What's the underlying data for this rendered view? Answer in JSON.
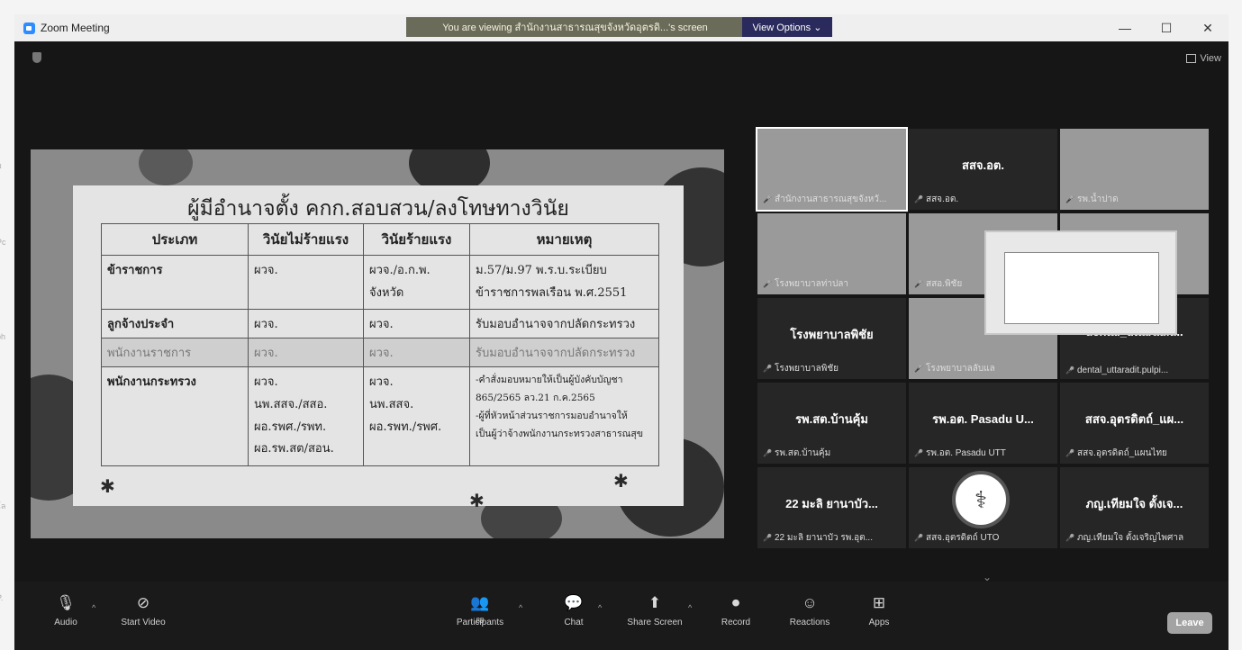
{
  "window": {
    "title": "Zoom Meeting",
    "viewing_banner": "You are viewing สำนักงานสาธารณสุขจังหวัดอุตรดิ...'s screen",
    "view_options": "View Options ⌄",
    "minimize": "—",
    "maximize": "☐",
    "close": "✕",
    "view_label": "View"
  },
  "slide": {
    "title": "ผู้มีอำนาจตั้ง คกก.สอบสวน/ลงโทษทางวินัย",
    "headers": [
      "ประเภท",
      "วินัยไม่ร้ายแรง",
      "วินัยร้ายแรง",
      "หมายเหตุ"
    ],
    "rows": [
      {
        "type": "ข้าราชการ",
        "minor": [
          "ผวจ."
        ],
        "major": [
          "ผวจ./อ.ก.พ.",
          "จังหวัด"
        ],
        "note": [
          "ม.57/ม.97 พ.ร.บ.ระเบียบ",
          "ข้าราชการพลเรือน พ.ศ.2551"
        ]
      },
      {
        "type": "ลูกจ้างประจำ",
        "minor": [
          "ผวจ."
        ],
        "major": [
          "ผวจ."
        ],
        "note": [
          "รับมอบอำนาจจากปลัดกระทรวง"
        ]
      },
      {
        "type": "พนักงานราชการ",
        "minor": [
          "ผวจ."
        ],
        "major": [
          "ผวจ."
        ],
        "note": [
          "รับมอบอำนาจจากปลัดกระทรวง"
        ]
      },
      {
        "type": "พนักงานกระทรวง",
        "minor": [
          "ผวจ.",
          "นพ.สสจ./สสอ.",
          "ผอ.รพศ./รพท.",
          "ผอ.รพ.สต/สอน."
        ],
        "major": [
          "ผวจ.",
          "นพ.สสจ.",
          "ผอ.รพท./รพศ."
        ],
        "note": [
          "-คำสั่งมอบหมายให้เป็นผู้บังคับบัญชา",
          "865/2565 ลว.21 ก.ค.2565",
          "-ผู้ที่หัวหน้าส่วนราชการมอบอำนาจให้",
          "เป็นผู้ว่าจ้างพนักงานกระทรวงสาธารณสุข"
        ]
      }
    ]
  },
  "gallery": [
    {
      "name": "",
      "label": "สำนักงานสาธารณสุขจังหวั..."
    },
    {
      "name": "สสจ.อต.",
      "label": "สสจ.อต."
    },
    {
      "name": "",
      "label": "รพ.น้ำปาด"
    },
    {
      "name": "",
      "label": "โรงพยาบาลท่าปลา"
    },
    {
      "name": "",
      "label": "สสอ.พิชัย"
    },
    {
      "name": "",
      "label": ""
    },
    {
      "name": "โรงพยาบาลพิชัย",
      "label": "โรงพยาบาลพิชัย"
    },
    {
      "name": "",
      "label": "โรงพยาบาลลับแล"
    },
    {
      "name": "dental_uttaradit...",
      "label": "dental_uttaradit.pulpi..."
    },
    {
      "name": "รพ.สต.บ้านคุ้ม",
      "label": "รพ.สต.บ้านคุ้ม"
    },
    {
      "name": "รพ.อต. Pasadu U...",
      "label": "รพ.อต. Pasadu UTT"
    },
    {
      "name": "สสจ.อุตรดิตถ์_แผ...",
      "label": "สสจ.อุตรดิตถ์_แผนไทย"
    },
    {
      "name": "22 มะลิ ยานาบัว...",
      "label": "22 มะลิ ยานาบัว รพ.อุต..."
    },
    {
      "name": "",
      "label": "สสจ.อุตรดิตถ์ UTO"
    },
    {
      "name": "ภญ.เทียมใจ ตั้งเจ...",
      "label": "ภญ.เทียมใจ ตั้งเจริญไพศาล"
    }
  ],
  "toolbar": {
    "audio": "Audio",
    "start_video": "Start Video",
    "participants": "Participants",
    "participant_count": "88",
    "chat": "Chat",
    "share_screen": "Share Screen",
    "record": "Record",
    "reactions": "Reactions",
    "apps": "Apps",
    "leave": "Leave"
  },
  "left_edge": {
    "t1": "ม",
    "t2": "Pc",
    "t3": "ph",
    "t4": "โล",
    "t5": "P."
  }
}
